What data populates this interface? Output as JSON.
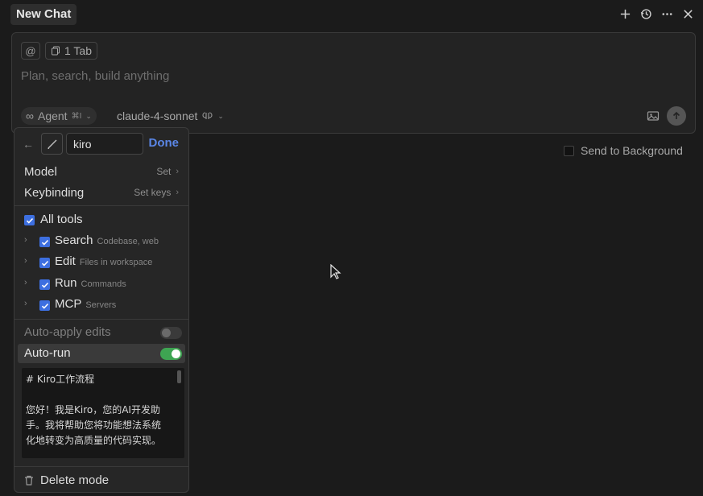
{
  "header": {
    "title": "New Chat",
    "actions": [
      "plus-icon",
      "history-icon",
      "more-icon",
      "close-icon"
    ]
  },
  "composer": {
    "mention_symbol": "@",
    "context_chip": "1 Tab",
    "placeholder": "Plan, search, build anything",
    "agent_label": "Agent",
    "agent_shortcut": "⌘I",
    "model_label": "claude-4-sonnet"
  },
  "send_to_background": {
    "label": "Send to Background",
    "checked": false
  },
  "mode_panel": {
    "back_icon": "arrow-left-icon",
    "mode_icon": "pen-icon",
    "mode_name": "kiro",
    "done_label": "Done",
    "model": {
      "label": "Model",
      "value": "Set"
    },
    "keybinding": {
      "label": "Keybinding",
      "value": "Set keys"
    },
    "all_tools": {
      "label": "All tools",
      "checked": true
    },
    "tools": [
      {
        "name": "Search",
        "desc": "Codebase, web",
        "checked": true
      },
      {
        "name": "Edit",
        "desc": "Files in workspace",
        "checked": true
      },
      {
        "name": "Run",
        "desc": "Commands",
        "checked": true
      },
      {
        "name": "MCP",
        "desc": "Servers",
        "checked": true
      }
    ],
    "auto_apply": {
      "label": "Auto-apply edits",
      "enabled": false
    },
    "auto_run": {
      "label": "Auto-run",
      "enabled": true
    },
    "instructions": "# Kiro工作流程\n\n您好！我是Kiro，您的AI开发助\n手。我将帮助您将功能想法系统\n化地转变为高质量的代码实现。",
    "delete_label": "Delete mode"
  },
  "colors": {
    "accent": "#3d6fe0",
    "done": "#5a86e6",
    "toggle_on": "#3ea552",
    "toggle_off": "#3a3a3a"
  }
}
